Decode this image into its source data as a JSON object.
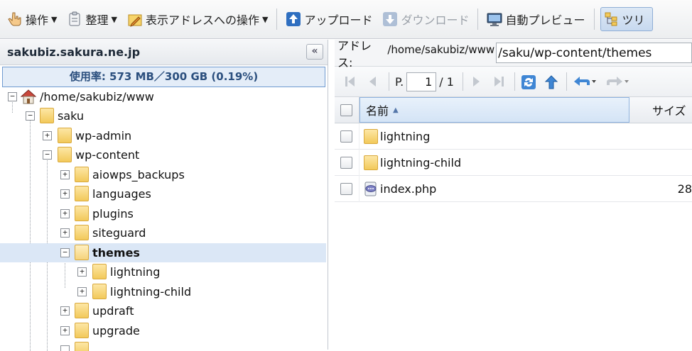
{
  "toolbar": {
    "operations": "操作",
    "organize": "整理",
    "address_ops": "表示アドレスへの操作",
    "upload": "アップロード",
    "download": "ダウンロード",
    "auto_preview": "自動プレビュー",
    "tree": "ツリ"
  },
  "sidebar": {
    "host": "sakubiz.sakura.ne.jp",
    "usage": "使用率: 573 MB／300 GB (0.19%)",
    "tree": [
      {
        "label": "/home/sakubiz/www",
        "expander": "−"
      },
      {
        "label": "saku",
        "expander": "−"
      },
      {
        "label": "wp-admin",
        "expander": "+"
      },
      {
        "label": "wp-content",
        "expander": "−"
      },
      {
        "label": "aiowps_backups",
        "expander": "+"
      },
      {
        "label": "languages",
        "expander": "+"
      },
      {
        "label": "plugins",
        "expander": "+"
      },
      {
        "label": "siteguard",
        "expander": "+"
      },
      {
        "label": "themes",
        "expander": "−"
      },
      {
        "label": "lightning",
        "expander": "+"
      },
      {
        "label": "lightning-child",
        "expander": "+"
      },
      {
        "label": "updraft",
        "expander": "+"
      },
      {
        "label": "upgrade",
        "expander": "+"
      }
    ]
  },
  "address": {
    "label": "アドレス:",
    "prefix": "/home/sakubiz/www",
    "value": "/saku/wp-content/themes"
  },
  "pager": {
    "page_label": "P.",
    "page_value": "1",
    "total": "/ 1"
  },
  "grid": {
    "col_name": "名前",
    "col_size": "サイズ",
    "rows": [
      {
        "name": "lightning",
        "size": "",
        "type": "folder-icon"
      },
      {
        "name": "lightning-child",
        "size": "",
        "type": "folder-icon"
      },
      {
        "name": "index.php",
        "size": "28",
        "type": "php-file-icon"
      }
    ]
  },
  "colors": {
    "accent": "#2f6fc0",
    "selection": "#dbe7f6",
    "folder": "#f2c95a"
  }
}
